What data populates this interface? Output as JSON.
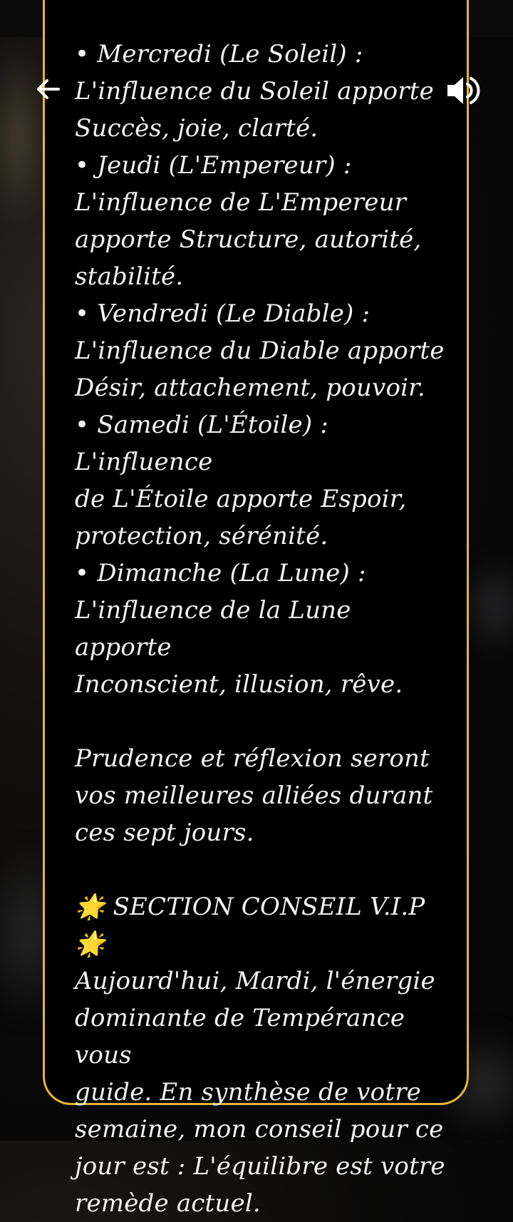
{
  "content": {
    "text": "• Mercredi (Le Soleil) :\nL'influence du Soleil apporte\nSuccès, joie, clarté.\n• Jeudi (L'Empereur) :\nL'influence de L'Empereur\napporte Structure, autorité,\nstabilité.\n• Vendredi (Le Diable) :\nL'influence du Diable apporte\nDésir, attachement, pouvoir.\n• Samedi (L'Étoile) : L'influence\nde L'Étoile apporte Espoir,\nprotection, sérénité.\n• Dimanche (La Lune) :\nL'influence de la Lune apporte\nInconscient, illusion, rêve.\n\nPrudence et réflexion seront\nvos meilleures alliées durant\nces sept jours.\n\n🌟 SECTION CONSEIL V.I.P 🌟\nAujourd'hui, Mardi, l'énergie\ndominante de Tempérance vous\nguide. En synthèse de votre\nsemaine, mon conseil pour ce\njour est : L'équilibre est votre\nremède actuel."
  },
  "icons": {
    "back": "arrow-left-icon",
    "sound": "speaker-volume-icon"
  },
  "colors": {
    "accent_border": "#e5b535",
    "card_background": "#000000",
    "text": "#f2f2f2"
  }
}
